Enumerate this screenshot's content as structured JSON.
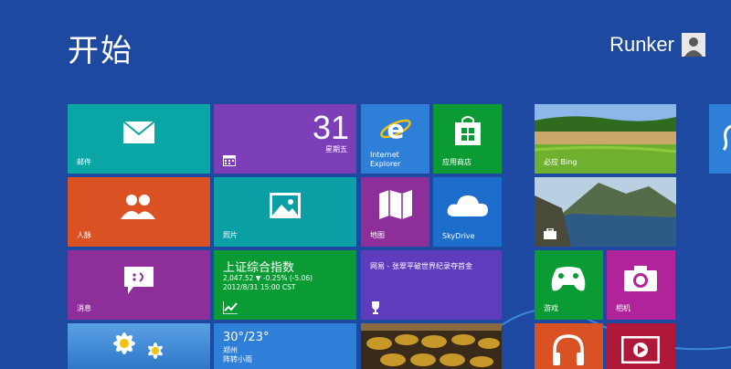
{
  "header": {
    "title": "开始",
    "user_name": "Runker"
  },
  "tiles": {
    "mail": {
      "label": "邮件",
      "color": "#0aa6a6"
    },
    "calendar": {
      "day_number": "31",
      "weekday": "星期五",
      "color": "#7c3fb8"
    },
    "ie": {
      "label_line1": "Internet",
      "label_line2": "Explorer",
      "color": "#2e7fd8"
    },
    "store": {
      "label": "应用商店",
      "color": "#0a9b35"
    },
    "people": {
      "label": "人脉",
      "color": "#da5124"
    },
    "photos": {
      "label": "照片",
      "color": "#0a9fa4"
    },
    "maps": {
      "label": "地图",
      "color": "#8e2e9a"
    },
    "skydrive": {
      "label": "SkyDrive",
      "color": "#1c6dcc"
    },
    "messaging": {
      "label": "消息",
      "color": "#8e2e9a"
    },
    "finance": {
      "title": "上证综合指数",
      "line1": "2,047.52 ▼ -0.25% (-5.06)",
      "line2": "2012/8/31 15:00 CST",
      "color": "#0a9b35"
    },
    "sports": {
      "headline": "网易 - 张翠平破世界纪录夺首金",
      "color": "#5f3bbd"
    },
    "bing": {
      "label": "必应 Bing"
    },
    "games": {
      "label": "游戏",
      "color": "#0a9b35"
    },
    "camera": {
      "label": "相机",
      "color": "#b0239a"
    },
    "weather": {
      "temp": "30°/23°",
      "city": "郑州",
      "condition": "阵转小雨",
      "color": "#2e7fd8"
    },
    "music": {
      "color": "#da5124"
    },
    "video": {
      "color": "#b0183a"
    }
  }
}
